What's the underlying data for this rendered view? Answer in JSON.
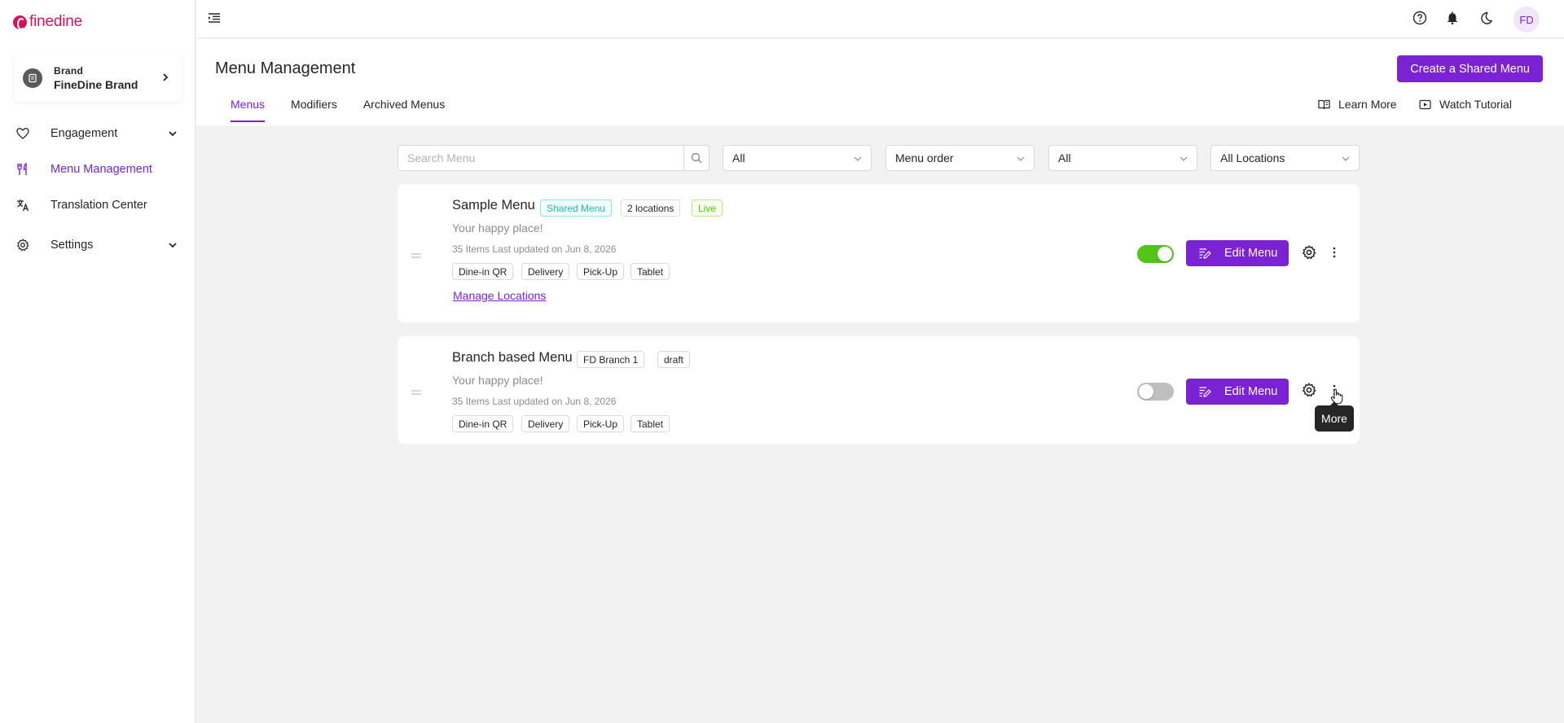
{
  "app": {
    "logo_text": "finedine",
    "accent_color": "#7b22d4"
  },
  "brand": {
    "label": "Brand",
    "name": "FineDine Brand"
  },
  "sidebar": {
    "items": [
      {
        "label": "Engagement",
        "icon": "heart-icon"
      },
      {
        "label": "Menu Management",
        "icon": "utensils-icon",
        "active": true
      },
      {
        "label": "Translation Center",
        "icon": "translate-icon"
      },
      {
        "label": "Settings",
        "icon": "gear-icon"
      }
    ]
  },
  "topbar": {
    "avatar_initials": "FD",
    "icons": [
      "help-icon",
      "bell-icon",
      "moon-icon"
    ]
  },
  "page": {
    "title": "Menu Management",
    "create_button": "Create a Shared Menu",
    "tabs": [
      "Menus",
      "Modifiers",
      "Archived Menus"
    ],
    "learn_more": "Learn More",
    "watch_tutorial": "Watch Tutorial"
  },
  "filters": {
    "search_placeholder": "Search Menu",
    "status": "All",
    "order": "Menu order",
    "type": "All",
    "locations": "All Locations"
  },
  "menus": [
    {
      "title": "Sample Menu",
      "tags": [
        "Shared Menu",
        "2 locations",
        "Live"
      ],
      "description": "Your happy place!",
      "meta": "35 Items Last updated on Jun 8, 2026",
      "channels": [
        "Dine-in QR",
        "Delivery",
        "Pick-Up",
        "Tablet"
      ],
      "manage_link": "Manage Locations",
      "enabled": true,
      "edit_label": "Edit Menu"
    },
    {
      "title": "Branch based Menu",
      "tags": [
        "FD Branch 1",
        "draft"
      ],
      "description": "Your happy place!",
      "meta": "35 Items Last updated on Jun 8, 2026",
      "channels": [
        "Dine-in QR",
        "Delivery",
        "Pick-Up",
        "Tablet"
      ],
      "enabled": false,
      "edit_label": "Edit Menu"
    }
  ],
  "tooltip": "More"
}
